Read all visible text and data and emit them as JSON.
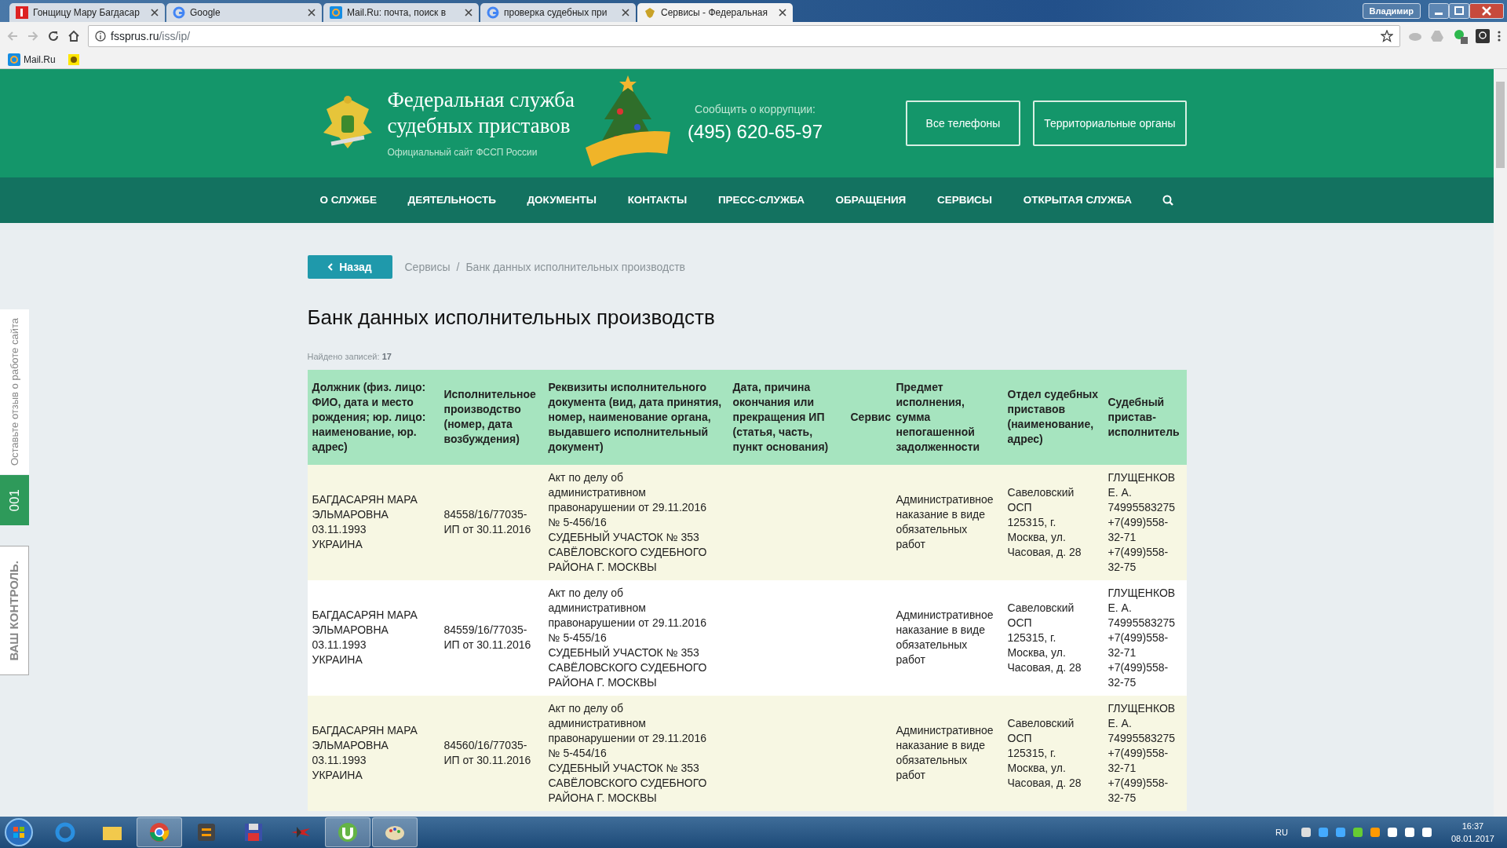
{
  "browser": {
    "tabs": [
      {
        "title": "Гонщицу Мару Багдасар",
        "kind": "yandex",
        "selected": false
      },
      {
        "title": "Google",
        "kind": "google",
        "selected": false
      },
      {
        "title": "Mail.Ru: почта, поиск в",
        "kind": "mail",
        "selected": false
      },
      {
        "title": "проверка судебных при",
        "kind": "google",
        "selected": false
      },
      {
        "title": "Сервисы - Федеральная",
        "kind": "emblem",
        "selected": true
      }
    ],
    "user": "Владимир",
    "address": {
      "host": "fssprus.ru",
      "path": "/iss/ip/"
    },
    "bookmarks": [
      {
        "label": "Mail.Ru",
        "kind": "mail"
      },
      {
        "kind": "badge"
      }
    ]
  },
  "site_header": {
    "title_line1": "Федеральная служба",
    "title_line2": "судебных приставов",
    "subtitle": "Официальный сайт ФССП России",
    "corruption_label": "Сообщить о коррупции:",
    "phone": "(495) 620-65-97",
    "buttons": [
      "Все телефоны",
      "Территориальные органы"
    ]
  },
  "nav": [
    "О СЛУЖБЕ",
    "ДЕЯТЕЛЬНОСТЬ",
    "ДОКУМЕНТЫ",
    "КОНТАКТЫ",
    "ПРЕСС-СЛУЖБА",
    "ОБРАЩЕНИЯ",
    "СЕРВИСЫ",
    "ОТКРЫТАЯ СЛУЖБА"
  ],
  "side_tabs": [
    {
      "label": "Оставьте отзыв о работе сайта",
      "kind": "feedback"
    },
    {
      "label": "001",
      "kind": "counter"
    },
    {
      "label": "ВАШ КОНТРОЛЬ.",
      "kind": "control"
    }
  ],
  "back_button": "Назад",
  "breadcrumb": {
    "items": [
      "Сервисы",
      "Банк данных исполнительных производств"
    ],
    "separator": "/"
  },
  "heading": "Банк данных исполнительных производств",
  "found": {
    "label": "Найдено записей:",
    "count": "17"
  },
  "table": {
    "columns": [
      "Должник (физ. лицо: ФИО, дата и место рождения; юр. лицо: наименование, юр. адрес)",
      "Исполнительное производство (номер, дата возбуждения)",
      "Реквизиты исполнительного документа (вид, дата принятия, номер, наименование органа, выдавшего исполнительный документ)",
      "Дата, причина окончания или прекращения ИП (статья, часть, пункт основания)",
      "Сервис",
      "Предмет исполнения, сумма непогашенной задолженности",
      "Отдел судебных приставов (наименование, адрес)",
      "Судебный пристав-исполнитель"
    ],
    "rows": [
      {
        "cells": [
          "БАГДАСАРЯН МАРА ЭЛЬМАРОВНА\n03.11.1993\nУКРАИНА",
          "84558/16/77035-ИП от 30.11.2016",
          "Акт по делу об административном правонарушении от 29.11.2016\n№ 5-456/16\nСУДЕБНЫЙ УЧАСТОК № 353 САВЁЛОВСКОГО СУДЕБНОГО РАЙОНА Г. МОСКВЫ",
          "",
          "",
          "Административное наказание в виде обязательных работ",
          "Савеловский ОСП\n125315, г. Москва, ул. Часовая, д. 28",
          "ГЛУЩЕНКОВ Е. А.\n74995583275\n+7(499)558-32-71\n+7(499)558-32-75"
        ]
      },
      {
        "cells": [
          "БАГДАСАРЯН МАРА ЭЛЬМАРОВНА\n03.11.1993\nУКРАИНА",
          "84559/16/77035-ИП от 30.11.2016",
          "Акт по делу об административном правонарушении от 29.11.2016\n№ 5-455/16\nСУДЕБНЫЙ УЧАСТОК № 353 САВЁЛОВСКОГО СУДЕБНОГО РАЙОНА Г. МОСКВЫ",
          "",
          "",
          "Административное наказание в виде обязательных работ",
          "Савеловский ОСП\n125315, г. Москва, ул. Часовая, д. 28",
          "ГЛУЩЕНКОВ Е. А.\n74995583275\n+7(499)558-32-71\n+7(499)558-32-75"
        ]
      },
      {
        "cells": [
          "БАГДАСАРЯН МАРА ЭЛЬМАРОВНА\n03.11.1993\nУКРАИНА",
          "84560/16/77035-ИП от 30.11.2016",
          "Акт по делу об административном правонарушении от 29.11.2016\n№ 5-454/16\nСУДЕБНЫЙ УЧАСТОК № 353 САВЁЛОВСКОГО СУДЕБНОГО РАЙОНА Г. МОСКВЫ",
          "",
          "",
          "Административное наказание в виде обязательных работ",
          "Савеловский ОСП\n125315, г. Москва, ул. Часовая, д. 28",
          "ГЛУЩЕНКОВ Е. А.\n74995583275\n+7(499)558-32-71\n+7(499)558-32-75"
        ]
      }
    ]
  },
  "taskbar": {
    "apps": [
      {
        "kind": "ie",
        "active": false
      },
      {
        "kind": "folder",
        "active": false
      },
      {
        "kind": "chrome",
        "active": true
      },
      {
        "kind": "sublime",
        "active": false
      },
      {
        "kind": "floppy",
        "active": false
      },
      {
        "kind": "plane",
        "active": false
      },
      {
        "kind": "torrent",
        "active": true
      },
      {
        "kind": "paint",
        "active": true
      }
    ],
    "language": "RU",
    "time": "16:37",
    "date": "08.01.2017"
  }
}
